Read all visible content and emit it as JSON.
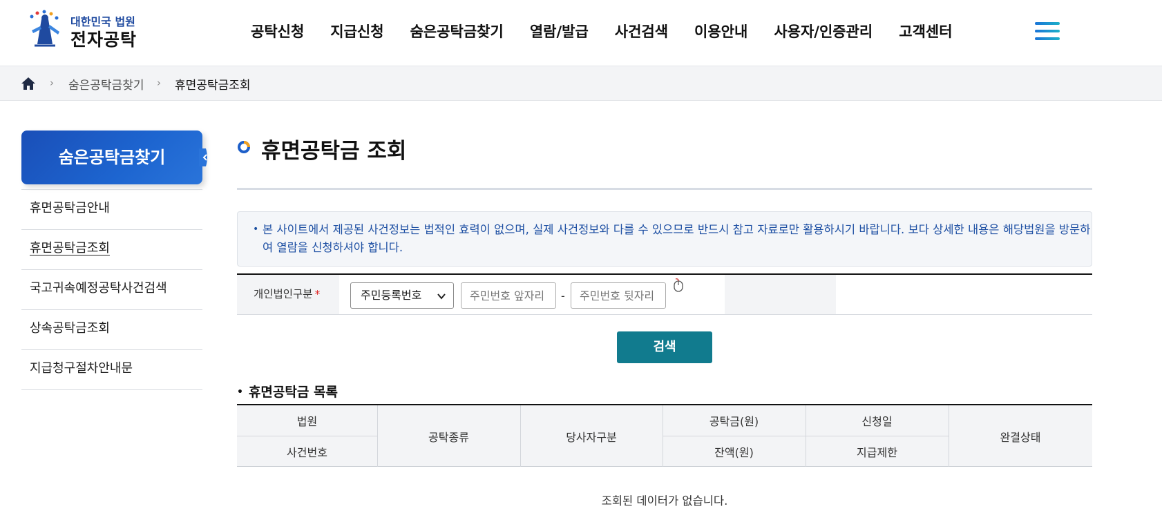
{
  "header": {
    "logo_top": "대한민국 법원",
    "logo_main": "전자공탁",
    "nav": [
      "공탁신청",
      "지급신청",
      "숨은공탁금찾기",
      "열람/발급",
      "사건검색",
      "이용안내",
      "사용자/인증관리",
      "고객센터"
    ]
  },
  "breadcrumb": {
    "items": [
      "숨은공탁금찾기",
      "휴면공탁금조회"
    ]
  },
  "sidebar": {
    "title": "숨은공탁금찾기",
    "items": [
      {
        "label": "휴면공탁금안내",
        "active": false
      },
      {
        "label": "휴면공탁금조회",
        "active": true
      },
      {
        "label": "국고귀속예정공탁사건검색",
        "active": false
      },
      {
        "label": "상속공탁금조회",
        "active": false
      },
      {
        "label": "지급청구절차안내문",
        "active": false
      }
    ]
  },
  "main": {
    "title": "휴면공탁금 조회",
    "notice": "본 사이트에서 제공된 사건정보는 법적인 효력이 없으며, 실제 사건정보와 다를 수 있으므로 반드시 참고 자료로만 활용하시기 바랍니다. 보다 상세한 내용은 해당법원을 방문하여 열람을 신청하셔야 합니다.",
    "form": {
      "label": "개인법인구분",
      "required_mark": "*",
      "select_value": "주민등록번호",
      "input1_placeholder": "주민번호 앞자리",
      "separator": "-",
      "input2_placeholder": "주민번호 뒷자리"
    },
    "search_button": "검색",
    "list_title": "휴면공탁금 목록",
    "table_headers": {
      "court": "법원",
      "case_no": "사건번호",
      "deposit_type": "공탁종류",
      "party_type": "당사자구분",
      "amount": "공탁금(원)",
      "balance": "잔액(원)",
      "apply_date": "신청일",
      "payment_limit": "지급제한",
      "status": "완결상태"
    },
    "empty_message": "조회된 데이터가 없습니다."
  },
  "colors": {
    "brand_blue": "#1d5fc9",
    "search_button": "#117b8e",
    "notice_text": "#1d4fa3"
  }
}
